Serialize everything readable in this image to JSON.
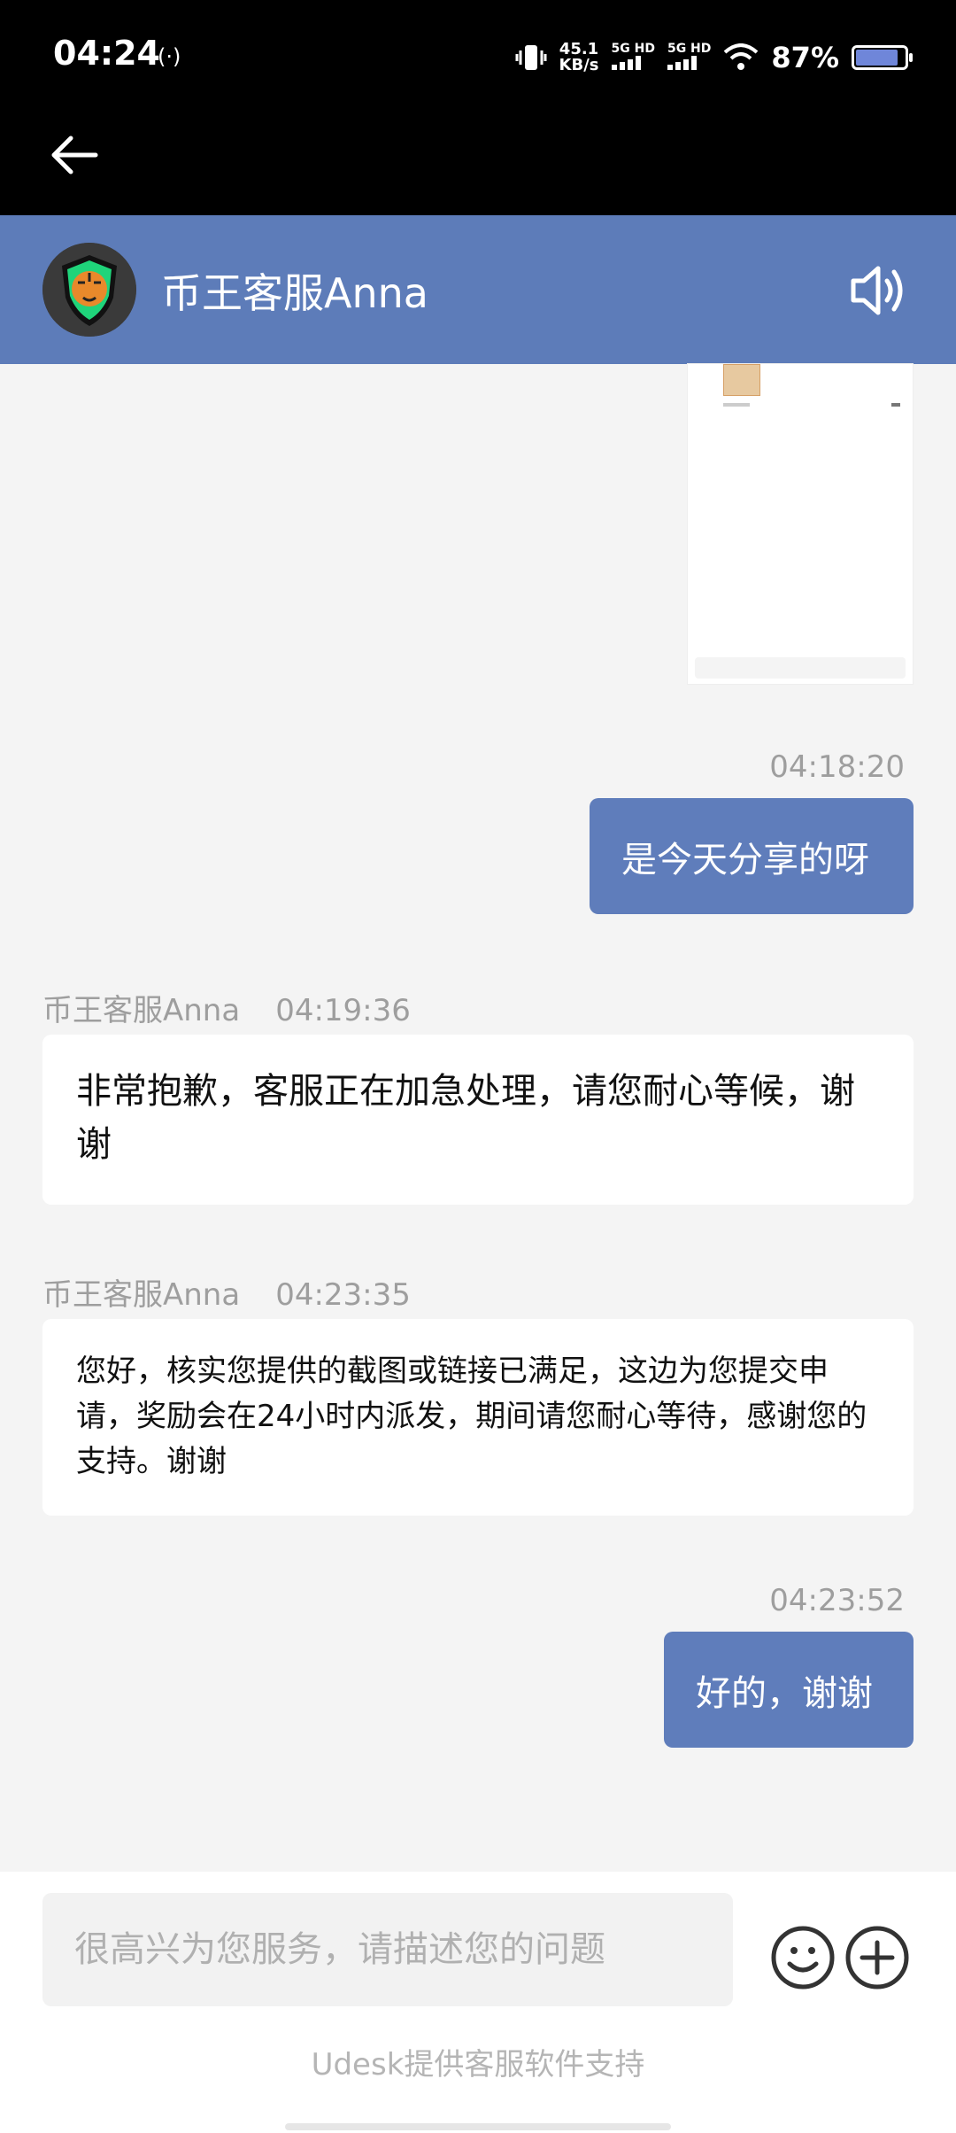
{
  "status_bar": {
    "time": "04:24",
    "speed_value": "45.1",
    "speed_unit": "KB/s",
    "net1": "5G HD",
    "net2": "5G HD",
    "battery_percent": "87%",
    "battery_level": 0.87
  },
  "header": {
    "agent_name": "币王客服Anna"
  },
  "messages": [
    {
      "side": "right",
      "time": "04:18:20",
      "text": "是今天分享的呀"
    },
    {
      "side": "left",
      "sender": "币王客服Anna",
      "time": "04:19:36",
      "text": "非常抱歉，客服正在加急处理，请您耐心等候，谢谢"
    },
    {
      "side": "left",
      "sender": "币王客服Anna",
      "time": "04:23:35",
      "text": "您好，核实您提供的截图或链接已满足，这边为您提交申请，奖励会在24小时内派发，期间请您耐心等待，感谢您的支持。谢谢"
    },
    {
      "side": "right",
      "time": "04:23:52",
      "text": "好的，谢谢"
    }
  ],
  "input": {
    "placeholder": "很高兴为您服务，请描述您的问题",
    "value": ""
  },
  "footer": {
    "powered_by": "Udesk提供客服软件支持"
  },
  "colors": {
    "header_bg": "#5d7cb9",
    "bubble_right": "#5f7dbb",
    "chat_bg": "#f4f4f4"
  },
  "icons": [
    "back-arrow-icon",
    "speaker-icon",
    "emoji-icon",
    "plus-icon",
    "wifi-icon",
    "vibrate-icon",
    "battery-icon"
  ]
}
